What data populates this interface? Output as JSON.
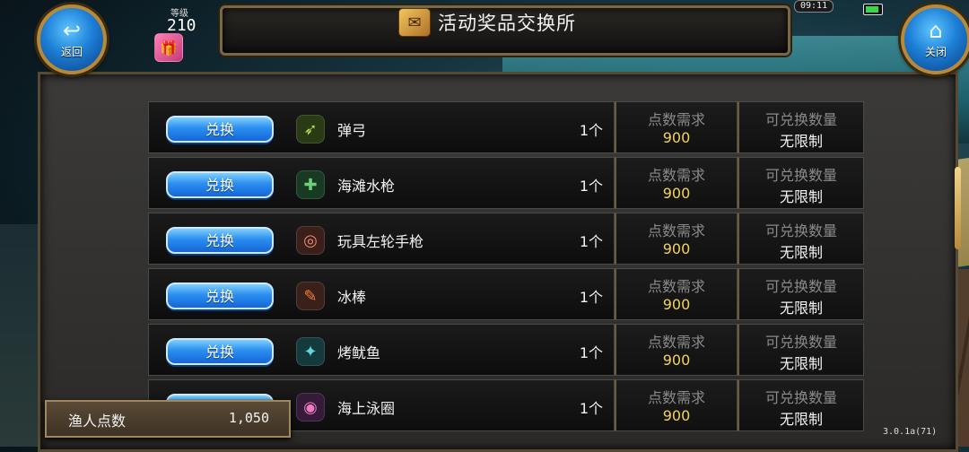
{
  "header": {
    "title": "活动奖品交换所",
    "back_label": "返回",
    "close_label": "关闭",
    "level_caption": "等级",
    "level_value": "210",
    "clock": "09:11"
  },
  "columns": {
    "points_label": "点数需求",
    "quantity_label": "可兑换数量"
  },
  "exchange_label": "兑换",
  "items": [
    {
      "name": "弹弓",
      "qty": "1个",
      "points": "900",
      "limit": "无限制",
      "icon": "slingshot-icon",
      "color": "#8ab33a"
    },
    {
      "name": "海滩水枪",
      "qty": "1个",
      "points": "900",
      "limit": "无限制",
      "icon": "water-gun-icon",
      "color": "#3d8a4a"
    },
    {
      "name": "玩具左轮手枪",
      "qty": "1个",
      "points": "900",
      "limit": "无限制",
      "icon": "toy-revolver-icon",
      "color": "#d06a5a"
    },
    {
      "name": "冰棒",
      "qty": "1个",
      "points": "900",
      "limit": "无限制",
      "icon": "popsicle-icon",
      "color": "#c65a3a"
    },
    {
      "name": "烤鱿鱼",
      "qty": "1个",
      "points": "900",
      "limit": "无限制",
      "icon": "grilled-squid-icon",
      "color": "#2a9aa0"
    },
    {
      "name": "海上泳圈",
      "qty": "1个",
      "points": "900",
      "limit": "无限制",
      "icon": "swim-ring-icon",
      "color": "#a04aa8"
    }
  ],
  "footer": {
    "points_label": "渔人点数",
    "points_value": "1,050",
    "version": "3.0.1a(71)"
  }
}
